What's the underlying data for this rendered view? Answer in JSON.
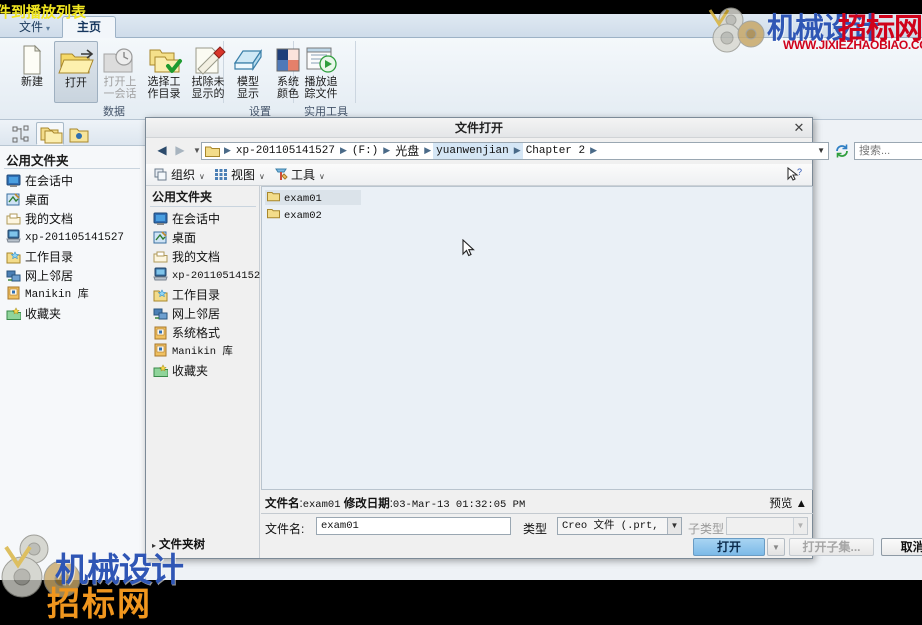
{
  "overlay": {
    "top_left_text": "件到播放列表"
  },
  "app": {
    "tabs": [
      {
        "name": "file",
        "label": "文件",
        "caret": "▾"
      },
      {
        "name": "home",
        "label": "主页"
      }
    ],
    "ribbon": {
      "groups": [
        {
          "name": "data",
          "label": "数据"
        },
        {
          "name": "settings",
          "label": "设置"
        },
        {
          "name": "utilities",
          "label": "实用工具"
        }
      ],
      "buttons": [
        {
          "name": "new",
          "label_line1": "新建",
          "label_line2": "",
          "icon": "new-document-icon",
          "selected": false,
          "disabled": false
        },
        {
          "name": "open",
          "label_line1": "打开",
          "label_line2": "",
          "icon": "open-folder-icon",
          "selected": true,
          "disabled": false
        },
        {
          "name": "open-last-session",
          "label_line1": "打开上",
          "label_line2": "一会话",
          "icon": "open-recent-icon",
          "selected": false,
          "disabled": true
        },
        {
          "name": "select-working-dir",
          "label_line1": "选择工",
          "label_line2": "作目录",
          "icon": "working-directory-icon",
          "selected": false,
          "disabled": false
        },
        {
          "name": "erase-not-displayed",
          "label_line1": "拭除未",
          "label_line2": "显示的",
          "icon": "erase-icon",
          "selected": false,
          "disabled": false
        },
        {
          "name": "model-display",
          "label_line1": "模型",
          "label_line2": "显示",
          "icon": "model-display-icon",
          "selected": false,
          "disabled": false
        },
        {
          "name": "system-colors",
          "label_line1": "系统",
          "label_line2": "颜色",
          "icon": "system-colors-icon",
          "selected": false,
          "disabled": false
        },
        {
          "name": "play-trail-file",
          "label_line1": "播放追",
          "label_line2": "踪文件",
          "icon": "play-trail-icon",
          "selected": false,
          "disabled": false
        }
      ]
    },
    "sidebar": {
      "nav_tabs": [
        {
          "name": "model-tree",
          "icon": "model-tree-icon",
          "active": false
        },
        {
          "name": "folder-browser",
          "icon": "folders-icon",
          "active": true
        },
        {
          "name": "favorites",
          "icon": "favorites-folder-icon",
          "active": false
        }
      ],
      "header": "公用文件夹",
      "items": [
        {
          "label": "在会话中",
          "icon": "in-session-icon"
        },
        {
          "label": "桌面",
          "icon": "desktop-icon"
        },
        {
          "label": "我的文档",
          "icon": "my-documents-icon"
        },
        {
          "label": "xp-201105141527",
          "icon": "computer-icon",
          "mono": true
        },
        {
          "label": "工作目录",
          "icon": "working-folder-icon"
        },
        {
          "label": "网上邻居",
          "icon": "network-icon"
        },
        {
          "label": "Manikin 库",
          "icon": "library-icon",
          "mono": true
        },
        {
          "label": "收藏夹",
          "icon": "favorites-icon"
        }
      ]
    }
  },
  "dialog": {
    "title": "文件打开",
    "close_label": "✕",
    "nav": {
      "back": "◀",
      "forward": "▶",
      "dropdown": "▼",
      "refresh_icon": "refresh-icon"
    },
    "breadcrumbs": [
      {
        "label": "xp-201105141527",
        "mono": true,
        "highlight": false
      },
      {
        "label": "(F:)",
        "mono": true,
        "highlight": false
      },
      {
        "label": "光盘",
        "mono": false,
        "highlight": false
      },
      {
        "label": "yuanwenjian",
        "mono": true,
        "highlight": true
      },
      {
        "label": "Chapter 2",
        "mono": true,
        "highlight": false
      }
    ],
    "breadcrumb_caret": "▼",
    "search": {
      "placeholder": "搜索..."
    },
    "commands": [
      {
        "name": "organize",
        "label": "组织",
        "icon": "organize-icon",
        "caret": "∨"
      },
      {
        "name": "view",
        "label": "视图",
        "icon": "view-icon",
        "caret": "∨"
      },
      {
        "name": "tools",
        "label": "工具",
        "icon": "tools-icon",
        "caret": "∨"
      }
    ],
    "help_icon": "help-pointer-icon",
    "sidebar": {
      "header": "公用文件夹",
      "items": [
        {
          "label": "在会话中",
          "icon": "in-session-icon"
        },
        {
          "label": "桌面",
          "icon": "desktop-icon"
        },
        {
          "label": "我的文档",
          "icon": "my-documents-icon"
        },
        {
          "label": "xp-201105141527",
          "icon": "computer-icon",
          "mono": true
        },
        {
          "label": "工作目录",
          "icon": "working-folder-icon"
        },
        {
          "label": "网上邻居",
          "icon": "network-icon"
        },
        {
          "label": "系统格式",
          "icon": "library-icon"
        },
        {
          "label": "Manikin 库",
          "icon": "library-icon",
          "mono": true
        },
        {
          "label": "收藏夹",
          "icon": "favorites-icon"
        }
      ],
      "folder_tree_label": "文件夹树",
      "folder_tree_caret": "▸"
    },
    "files": [
      {
        "name": "exam01",
        "icon": "folder-icon",
        "selected": true
      },
      {
        "name": "exam02",
        "icon": "folder-icon",
        "selected": false
      }
    ],
    "info": {
      "filename_key": "文件名",
      "filename_value": "exam01",
      "modified_key": "修改日期",
      "modified_value": "03-Mar-13 01:32:05 PM",
      "preview_label": "预览",
      "preview_caret": "▲"
    },
    "form": {
      "filename_label": "文件名:",
      "filename_value": "exam01",
      "type_label": "类型",
      "type_value": "Creo 文件 (.prt, .as",
      "type_caret": "▼",
      "subtype_label": "子类型",
      "subtype_value": "",
      "subtype_caret": "▼"
    },
    "buttons": {
      "open": "打开",
      "open_caret": "▼",
      "open_subset": "打开子集...",
      "cancel": "取消(C)"
    }
  },
  "watermarks": {
    "top": {
      "text_blue": "机械设计",
      "text_red": "招标网",
      "url": "WWW.JIXIEZHAOBIAO.COM",
      "color_blue": "#2f56b5",
      "color_red": "#d0021b"
    },
    "bottom": {
      "text_blue": "机械设计",
      "text_orange": "招标网",
      "color_blue": "#2f56b5",
      "color_orange": "#f0961e"
    }
  }
}
